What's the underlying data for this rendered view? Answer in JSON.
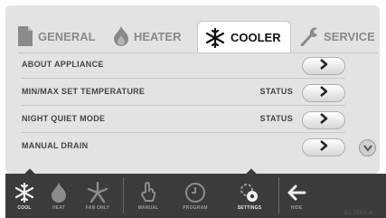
{
  "tabs": [
    {
      "label": "GENERAL",
      "icon": "document-icon",
      "active": false
    },
    {
      "label": "HEATER",
      "icon": "flame-icon",
      "active": false
    },
    {
      "label": "COOLER",
      "icon": "snowflake-icon",
      "active": true
    },
    {
      "label": "SERVICE",
      "icon": "wrench-icon",
      "active": false
    }
  ],
  "rows": [
    {
      "label": "ABOUT APPLIANCE",
      "status": ""
    },
    {
      "label": "MIN/MAX SET TEMPERATURE",
      "status": "STATUS"
    },
    {
      "label": "NIGHT QUIET MODE",
      "status": "STATUS"
    },
    {
      "label": "MANUAL DRAIN",
      "status": ""
    }
  ],
  "bottom_nav": [
    {
      "label": "COOL",
      "icon": "snowflake-icon",
      "active": true
    },
    {
      "label": "HEAT",
      "icon": "flame-icon",
      "active": false
    },
    {
      "label": "FAN ONLY",
      "icon": "fan-icon",
      "active": false
    },
    {
      "label": "MANUAL",
      "icon": "hand-icon",
      "active": false
    },
    {
      "label": "PROGRAM",
      "icon": "clock-icon",
      "active": false
    },
    {
      "label": "SETTINGS",
      "icon": "settings-icon",
      "active": true
    },
    {
      "label": "HIDE",
      "icon": "back-arrow-icon",
      "active": false
    }
  ],
  "watermark": "ILL1664-A",
  "colors": {
    "panel_bg": "#e3e3e3",
    "bottom_bar": "#3b3b3b",
    "active_tab_bg": "#ffffff"
  }
}
